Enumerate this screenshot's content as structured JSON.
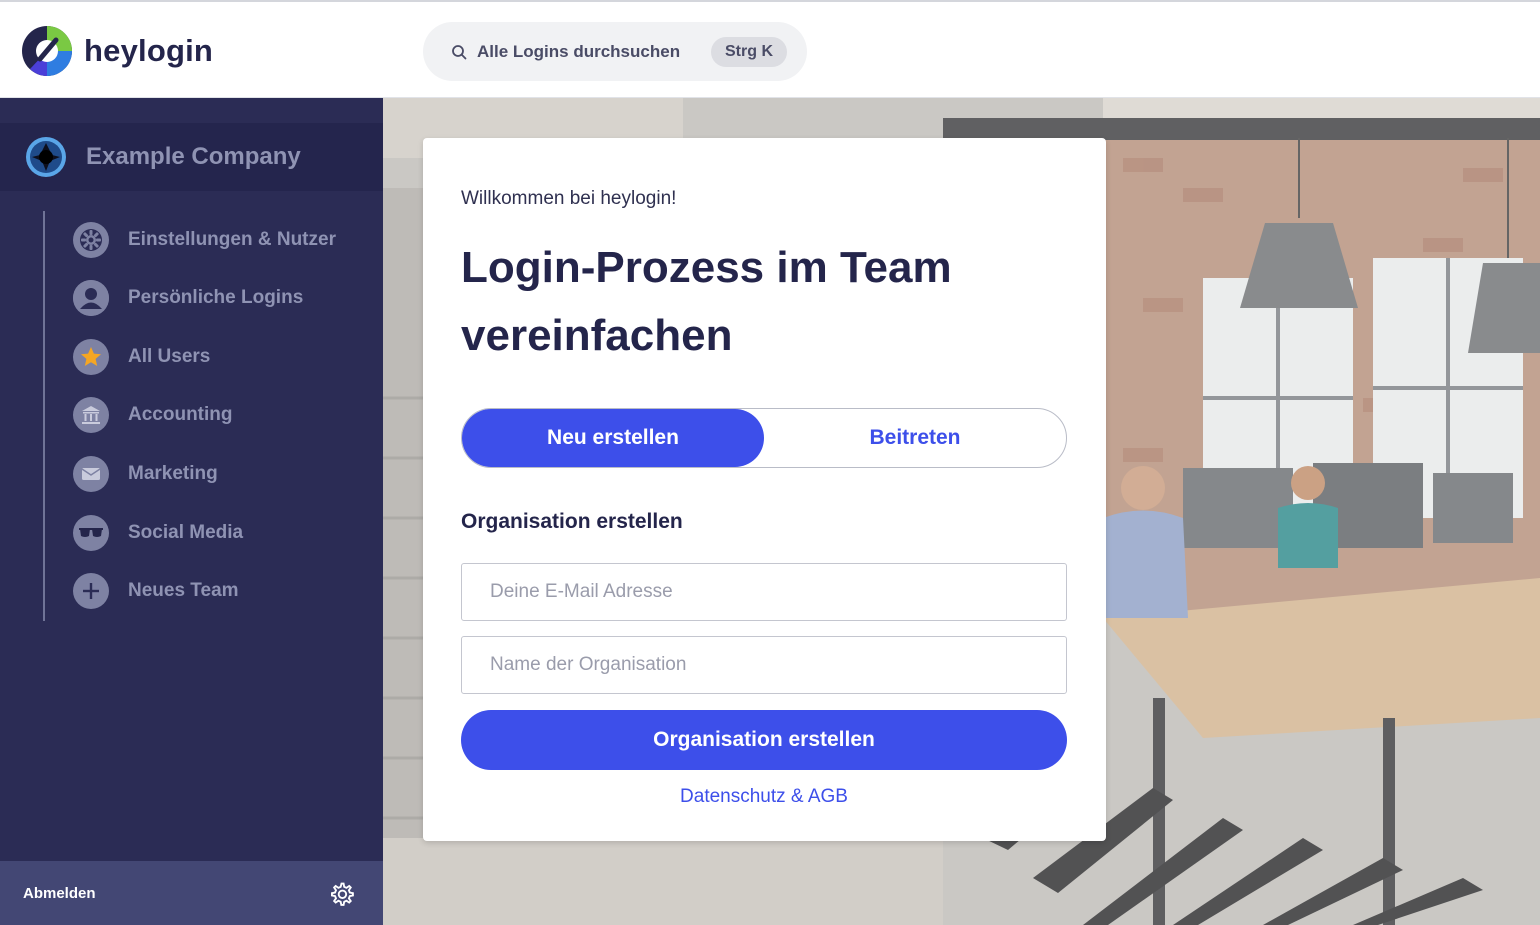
{
  "header": {
    "brand": "heylogin",
    "search_text": "Alle Logins durchsuchen",
    "search_shortcut": "Strg K"
  },
  "sidebar": {
    "company": "Example Company",
    "items": [
      {
        "label": "Einstellungen & Nutzer",
        "icon": "gear-icon"
      },
      {
        "label": "Persönliche Logins",
        "icon": "user-icon"
      },
      {
        "label": "All Users",
        "icon": "star-icon"
      },
      {
        "label": "Accounting",
        "icon": "bank-icon"
      },
      {
        "label": "Marketing",
        "icon": "envelope-icon"
      },
      {
        "label": "Social Media",
        "icon": "sunglasses-icon"
      },
      {
        "label": "Neues Team",
        "icon": "plus-icon"
      }
    ],
    "logout": "Abmelden"
  },
  "card": {
    "welcome": "Willkommen bei heylogin!",
    "title": "Login-Prozess im Team vereinfachen",
    "tab_new": "Neu erstellen",
    "tab_join": "Beitreten",
    "section_title": "Organisation erstellen",
    "email_placeholder": "Deine E-Mail Adresse",
    "org_placeholder": "Name der Organisation",
    "submit_label": "Organisation erstellen",
    "legal_link": "Datenschutz & AGB"
  },
  "colors": {
    "accent": "#3d4fea",
    "sidebar_bg": "#2b2c55",
    "sidebar_text": "#8f93b3",
    "star": "#f5a623"
  }
}
